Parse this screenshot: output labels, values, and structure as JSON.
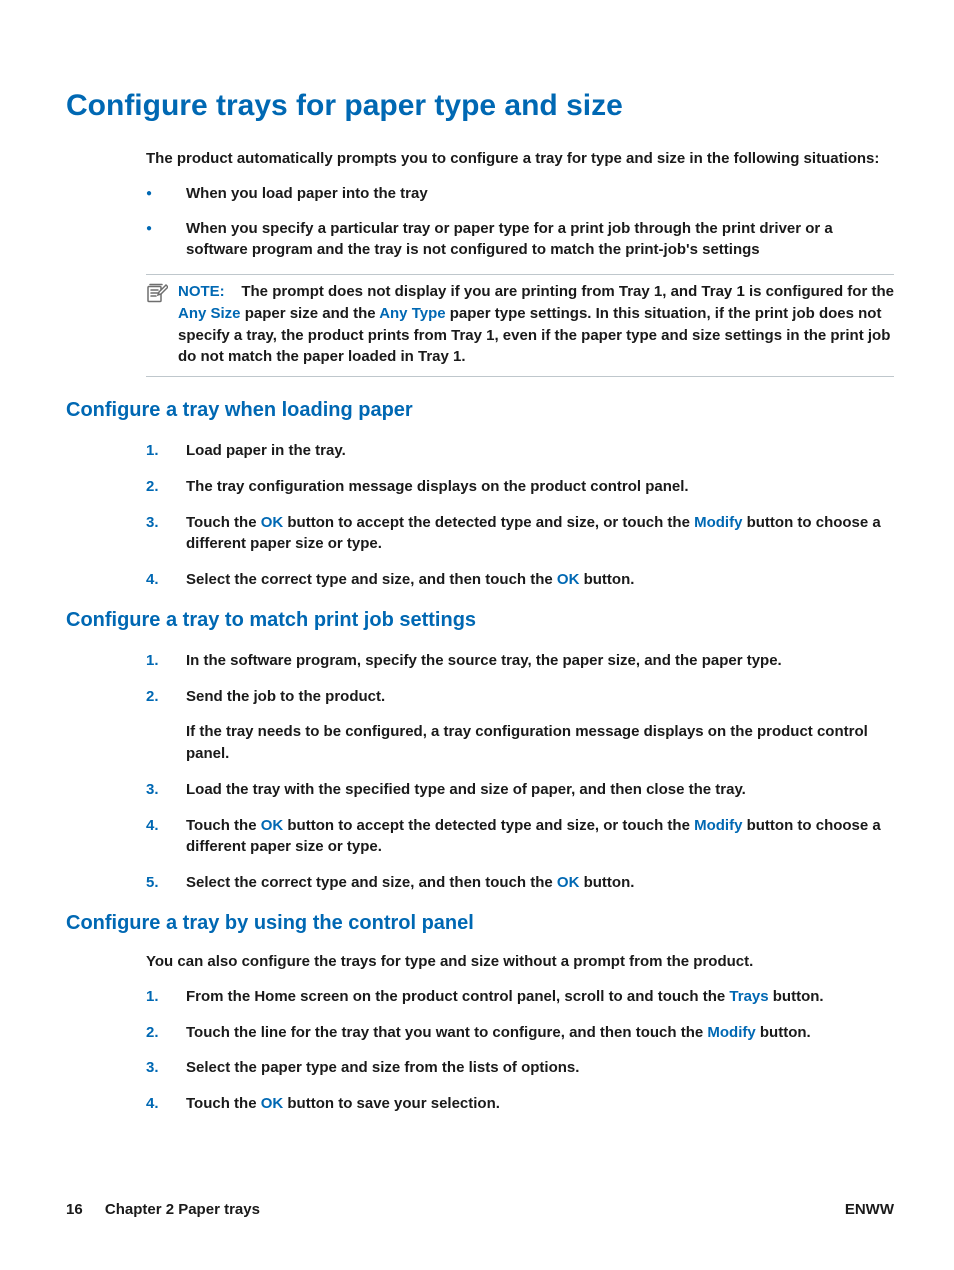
{
  "title": "Configure trays for paper type and size",
  "intro": "The product automatically prompts you to configure a tray for type and size in the following situations:",
  "bullets": [
    "When you load paper into the tray",
    "When you specify a particular tray or paper type for a print job through the print driver or a software program and the tray is not configured to match the print-job's settings"
  ],
  "note": {
    "label": "NOTE:",
    "pre": "The prompt does not display if you are printing from Tray 1, and Tray 1 is configured for the ",
    "any_size": "Any Size",
    "mid1": " paper size and the ",
    "any_type": "Any Type",
    "post": " paper type settings. In this situation, if the print job does not specify a tray, the product prints from Tray 1, even if the paper type and size settings in the print job do not match the paper loaded in Tray 1."
  },
  "section1": {
    "heading": "Configure a tray when loading paper",
    "step1": "Load paper in the tray.",
    "step2": "The tray configuration message displays on the product control panel.",
    "step3": {
      "a": "Touch the ",
      "ok": "OK",
      "b": " button to accept the detected type and size, or touch the ",
      "modify": "Modify",
      "c": " button to choose a different paper size or type."
    },
    "step4": {
      "a": "Select the correct type and size, and then touch the ",
      "ok": "OK",
      "b": " button."
    }
  },
  "section2": {
    "heading": "Configure a tray to match print job settings",
    "step1": "In the software program, specify the source tray, the paper size, and the paper type.",
    "step2": {
      "a": "Send the job to the product.",
      "sub": "If the tray needs to be configured, a tray configuration message displays on the product control panel."
    },
    "step3": "Load the tray with the specified type and size of paper, and then close the tray.",
    "step4": {
      "a": "Touch the ",
      "ok": "OK",
      "b": " button to accept the detected type and size, or touch the ",
      "modify": "Modify",
      "c": " button to choose a different paper size or type."
    },
    "step5": {
      "a": "Select the correct type and size, and then touch the ",
      "ok": "OK",
      "b": " button."
    }
  },
  "section3": {
    "heading": "Configure a tray by using the control panel",
    "intro": "You can also configure the trays for type and size without a prompt from the product.",
    "step1": {
      "a": "From the Home screen on the product control panel, scroll to and touch the ",
      "trays": "Trays",
      "b": " button."
    },
    "step2": {
      "a": "Touch the line for the tray that you want to configure, and then touch the ",
      "modify": "Modify",
      "b": " button."
    },
    "step3": "Select the paper type and size from the lists of options.",
    "step4": {
      "a": "Touch the ",
      "ok": "OK",
      "b": " button to save your selection."
    }
  },
  "footer": {
    "page_number": "16",
    "chapter": "Chapter 2   Paper trays",
    "locale": "ENWW"
  }
}
